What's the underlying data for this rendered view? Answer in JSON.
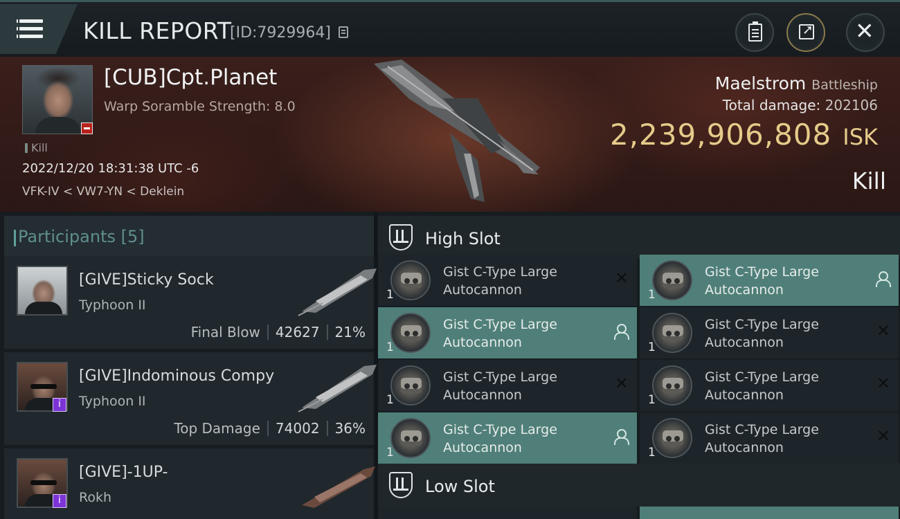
{
  "header": {
    "title": "KILL REPORT",
    "report_id": "[ID:7929964]"
  },
  "victim": {
    "name": "[CUB]Cpt.Planet",
    "subtitle": "Warp Soramble Strength: 8.0",
    "tag": "Kill",
    "datetime": "2022/12/20 18:31:38 UTC -6",
    "location": "VFK-IV < VW7-YN < Deklein",
    "ship_name": "Maelstrom",
    "ship_class": "Battleship",
    "total_damage_label": "Total damage:",
    "total_damage_value": "202106",
    "isk_value": "2,239,906,808",
    "isk_unit": "ISK",
    "result": "Kill"
  },
  "participants": {
    "label": "Participants",
    "count": "[5]",
    "items": [
      {
        "name": "[GIVE]Sticky Sock",
        "ship": "Typhoon II",
        "stat_label": "Final Blow",
        "damage": "42627",
        "percent": "21%"
      },
      {
        "name": "[GIVE]Indominous Compy",
        "ship": "Typhoon II",
        "stat_label": "Top Damage",
        "damage": "74002",
        "percent": "36%"
      },
      {
        "name": "[GIVE]-1UP-",
        "ship": "Rokh"
      }
    ]
  },
  "slots": {
    "high_label": "High Slot",
    "low_label": "Low Slot",
    "module_name": "Gist C-Type Large Autocannon",
    "modules": [
      {
        "qty": "1",
        "name": "Gist C-Type Large Autocannon",
        "status": "destroyed"
      },
      {
        "qty": "1",
        "name": "Gist C-Type Large Autocannon",
        "status": "dropped"
      },
      {
        "qty": "1",
        "name": "Gist C-Type Large Autocannon",
        "status": "dropped"
      },
      {
        "qty": "1",
        "name": "Gist C-Type Large Autocannon",
        "status": "destroyed"
      },
      {
        "qty": "1",
        "name": "Gist C-Type Large Autocannon",
        "status": "destroyed"
      },
      {
        "qty": "1",
        "name": "Gist C-Type Large Autocannon",
        "status": "destroyed"
      },
      {
        "qty": "1",
        "name": "Gist C-Type Large Autocannon",
        "status": "dropped"
      },
      {
        "qty": "1",
        "name": "Gist C-Type Large Autocannon",
        "status": "destroyed"
      }
    ]
  },
  "colors": {
    "isk_gold": "#e5cb8a",
    "highlight_teal": "#4f7f78",
    "negative_red": "#b8211c",
    "corp_purple": "#7d34d6"
  },
  "icons": [
    "menu-icon",
    "copy-icon",
    "clipboard-icon",
    "share-icon",
    "close-icon",
    "slot-icon",
    "person-icon",
    "x-icon"
  ]
}
